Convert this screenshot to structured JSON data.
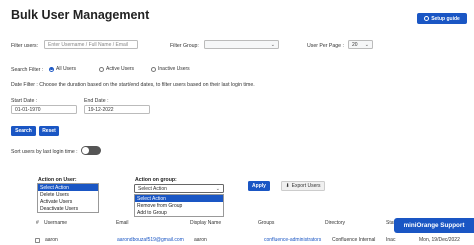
{
  "header": {
    "title": "Bulk User Management",
    "setup_label": "Setup guide"
  },
  "filters": {
    "users_label": "Filter users:",
    "users_placeholder": "Enter Username / Full Name / Email",
    "group_label": "Filter Group:",
    "group_value": "",
    "per_page_label": "User Per Page :",
    "per_page_value": "20"
  },
  "search_filter": {
    "label": "Search Filter :",
    "options": [
      "All Users",
      "Active Users",
      "Inactive Users"
    ],
    "selected": "All Users"
  },
  "date_filter": {
    "label": "Date Filter : Choose the duration based on the start/end dates, to filter users based on their last login time.",
    "start_label": "Start Date :",
    "start_value": "01-01-1970",
    "end_label": "End Date :",
    "end_value": "19-12-2022"
  },
  "actions": {
    "search_label": "Search",
    "reset_label": "Reset"
  },
  "sort": {
    "label": "Sort users by last login time :",
    "enabled": false
  },
  "bulk": {
    "user_action_label": "Action on User:",
    "user_action_options": [
      "Select Action",
      "Delete Users",
      "Activate Users",
      "Deactivate Users"
    ],
    "user_action_selected": "Select Action",
    "group_action_label": "Action on group:",
    "group_action_value": "Select Action",
    "group_action_options": [
      "Select Action",
      "Remove from Group",
      "Add to Group"
    ],
    "apply_label": "Apply",
    "export_label": "Export Users"
  },
  "table": {
    "columns": [
      "#",
      "Username",
      "Email",
      "Display Name",
      "Groups",
      "Directory",
      "Stat"
    ],
    "rows": [
      {
        "username": "aaron",
        "email": "aarondbouzaf519@gmail.com",
        "display_name": "aaron",
        "groups": "confluence-administrators",
        "directory": "Confluence Internal",
        "status": "Inac",
        "last_login": "Mon, 19/Dec/2022"
      }
    ]
  },
  "support": {
    "label": "miniOrange Support"
  }
}
